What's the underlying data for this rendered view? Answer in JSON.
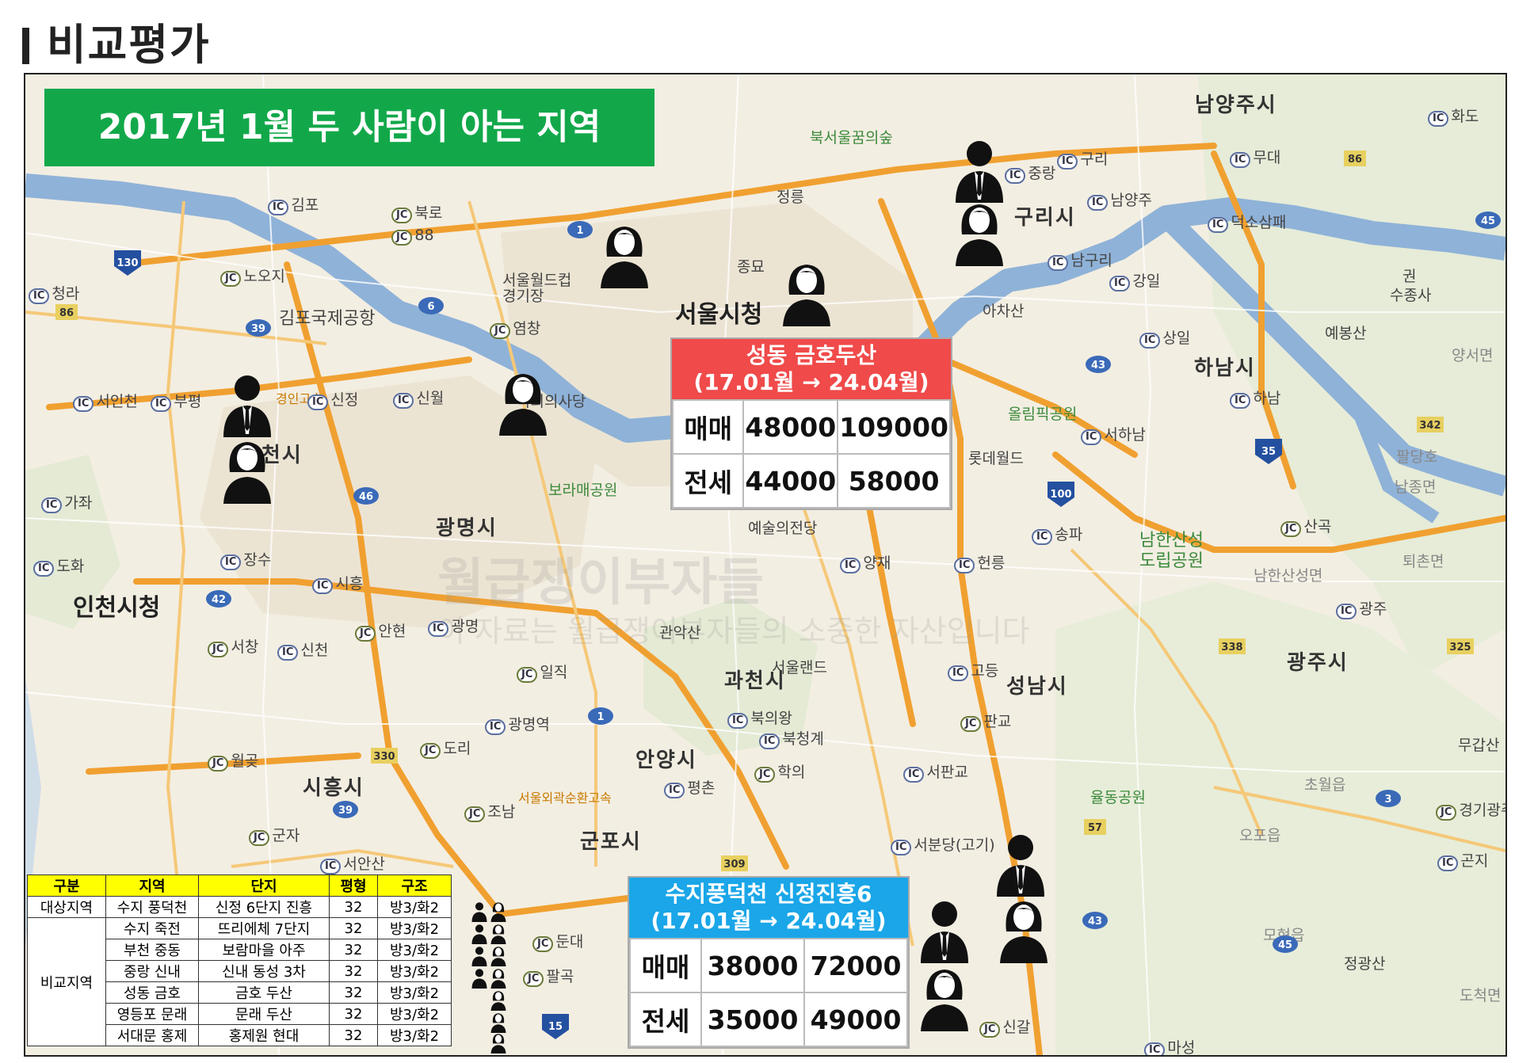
{
  "page": {
    "title": "비교평가"
  },
  "banner": {
    "text": "2017년 1월 두 사람이 아는 지역"
  },
  "map_labels": {
    "cities": {
      "seoul": "서울시청",
      "incheon": "인천시청",
      "guri": "구리시",
      "hanam": "하남시",
      "gwangmyeong": "광명시",
      "gwacheon": "과천시",
      "anyang": "안양시",
      "siheung": "시흥시",
      "gunpo": "군포시",
      "seongnam": "성남시",
      "gwangju": "광주시",
      "namyangju": "남양주시",
      "bucheon_partial": "부천시"
    },
    "places": {
      "bukseoul_forest": "북서울꿈의숲",
      "jeongneung": "정릉",
      "jongmyo": "종묘",
      "worldcup": "서울월드컵\n경기장",
      "gimpo_airport": "김포국제공항",
      "national_assembly": "국회의사당",
      "boramae": "보라매공원",
      "seoul_arts": "예술의전당",
      "gwanaksan": "관악산",
      "seoul_land": "서울랜드",
      "achasan": "아차산",
      "olympic_park": "올림픽공원",
      "lotte_world": "롯데월드",
      "namhansanseong": "남한산성\n도립공원",
      "yulmong": "율동공원",
      "yebongsan": "예봉산",
      "palgakho": "팔당호",
      "namjongmyeon": "남종면",
      "toechon": "퇴촌면",
      "yangseo": "양서면",
      "sujongsa": "수종사",
      "gakgo": "권",
      "jeonggwangsan": "정광산",
      "chowoleup": "초월읍",
      "ohpoeup": "오포읍",
      "mohyeon": "모현읍",
      "dogcheok": "도척면",
      "muggap": "무갑산",
      "namhansanseong_myeon": "남한산성면",
      "seoul_ring": "서울외곽순환고속",
      "gyeongin": "경인고속"
    },
    "interchanges": [
      "김포",
      "북로",
      "88",
      "노오지",
      "청라",
      "구리",
      "중랑",
      "무대",
      "남양주",
      "덕소삼패",
      "남구리",
      "강일",
      "상일",
      "하남",
      "서하남",
      "송파",
      "헌릉",
      "양재",
      "산곡",
      "광주",
      "고등",
      "판교",
      "서판교",
      "서분당(고기)",
      "북의왕",
      "북청계",
      "학의",
      "평촌",
      "일직",
      "광명역",
      "도리",
      "월곶",
      "조남",
      "서창",
      "신천",
      "안현",
      "광명",
      "장수",
      "시흥",
      "가좌",
      "도화",
      "서인천",
      "부평",
      "신월",
      "염창",
      "신정",
      "서안산",
      "군자",
      "둔대",
      "팔곡",
      "신갈",
      "마성",
      "곤지",
      "경기광주",
      "화도"
    ]
  },
  "route_shields": [
    "130",
    "86",
    "39",
    "6",
    "1",
    "42",
    "46",
    "100",
    "35",
    "342",
    "86",
    "338",
    "325",
    "330",
    "39",
    "57",
    "309",
    "43",
    "3",
    "15",
    "45",
    "1",
    "43",
    "45"
  ],
  "card_seongdong": {
    "title": "성동 금호두산",
    "period": "(17.01월 → 24.04월)",
    "header_color": "#f04a4a",
    "rows": [
      {
        "label": "매매",
        "v1": "48000",
        "v2": "109000"
      },
      {
        "label": "전세",
        "v1": "44000",
        "v2": "58000"
      }
    ]
  },
  "card_suji": {
    "title": "수지풍덕천 신정진흥6",
    "period": "(17.01월 → 24.04월)",
    "header_color": "#1aa6e8",
    "rows": [
      {
        "label": "매매",
        "v1": "38000",
        "v2": "72000"
      },
      {
        "label": "전세",
        "v1": "35000",
        "v2": "49000"
      }
    ]
  },
  "comparison_table": {
    "headers": [
      "구분",
      "지역",
      "단지",
      "평형",
      "구조"
    ],
    "target_group": "대상지역",
    "compare_group": "비교지역",
    "rows": [
      {
        "region": "수지 풍덕천",
        "complex": "신정 6단지 진흥",
        "size": "32",
        "layout": "방3/화2"
      },
      {
        "region": "수지 죽전",
        "complex": "뜨리에체 7단지",
        "size": "32",
        "layout": "방3/화2"
      },
      {
        "region": "부천 중동",
        "complex": "보람마을 아주",
        "size": "32",
        "layout": "방3/화2"
      },
      {
        "region": "중랑 신내",
        "complex": "신내 동성 3차",
        "size": "32",
        "layout": "방3/화2"
      },
      {
        "region": "성동 금호",
        "complex": "금호 두산",
        "size": "32",
        "layout": "방3/화2"
      },
      {
        "region": "영등포 문래",
        "complex": "문래 두산",
        "size": "32",
        "layout": "방3/화2"
      },
      {
        "region": "서대문 홍제",
        "complex": "홍제원 현대",
        "size": "32",
        "layout": "방3/화2"
      }
    ]
  },
  "watermark": {
    "line1": "월급쟁이부자들",
    "line2": "이 자료는 월급쟁이부자들의 소중한 자산입니다"
  },
  "colors": {
    "banner": "#12a84a",
    "table_header": "#ffff00",
    "river": "#8fb2d8",
    "expressway": "#f0a030"
  }
}
